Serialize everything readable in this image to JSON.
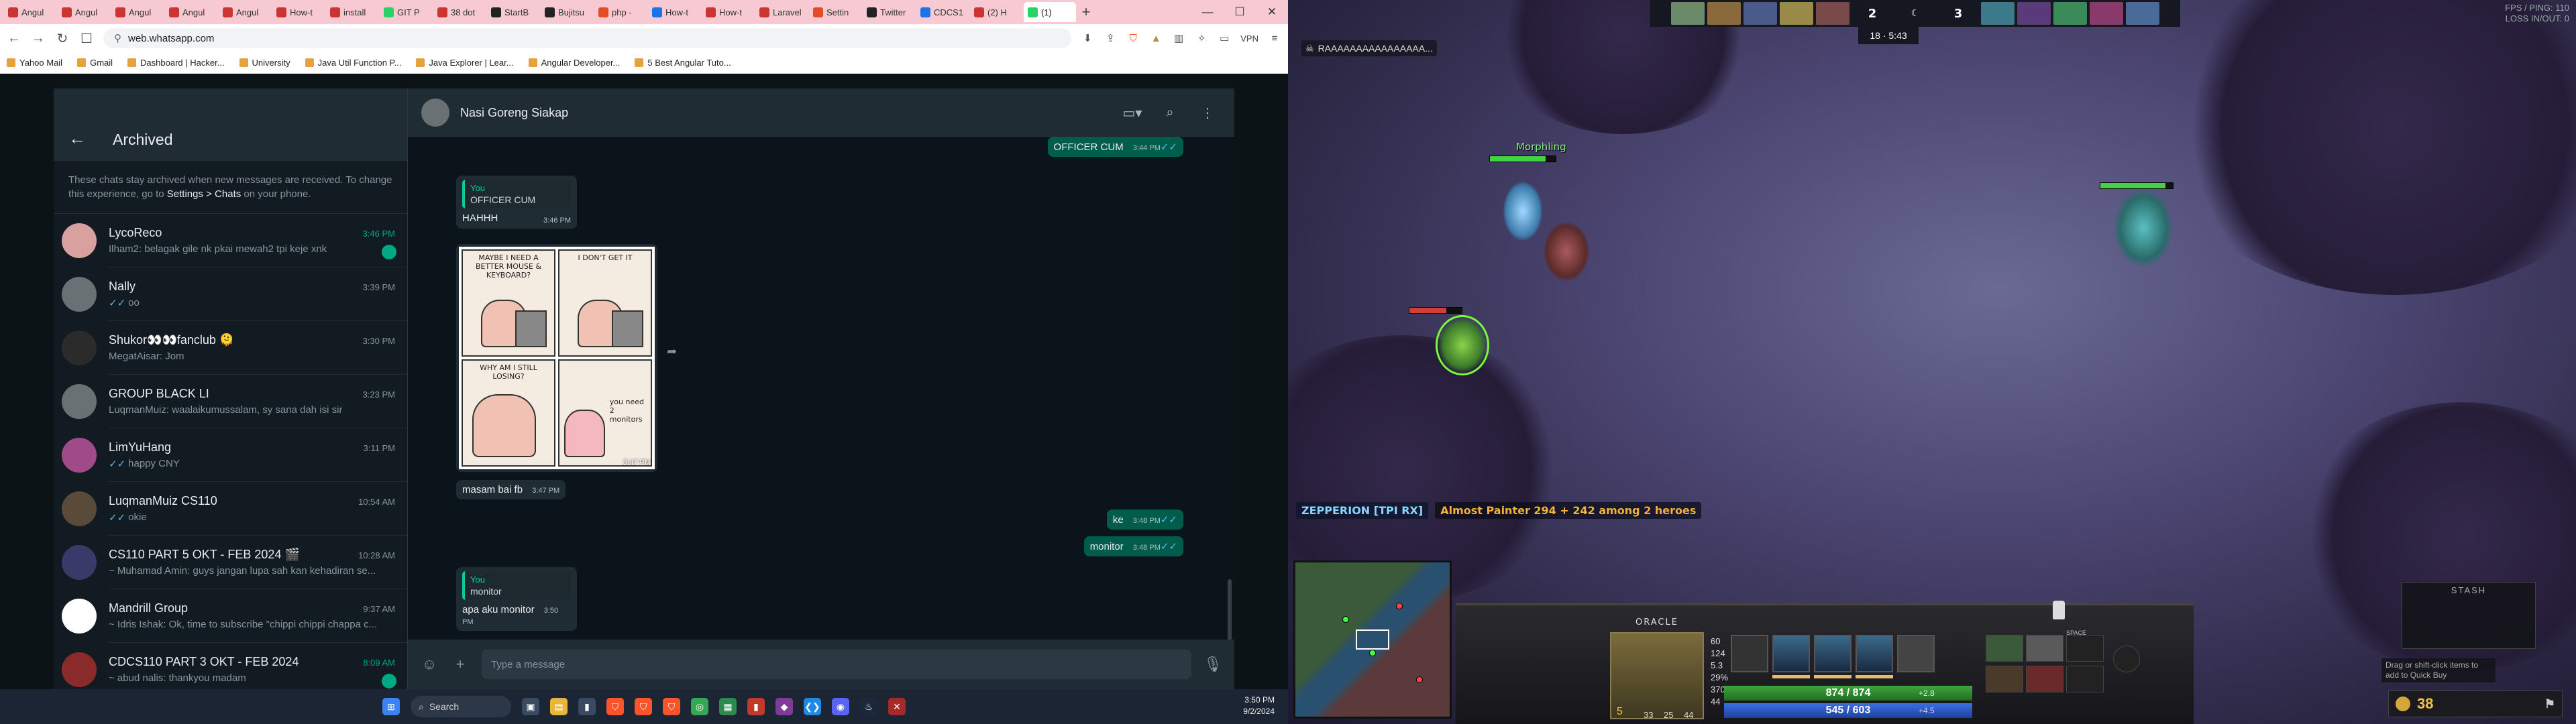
{
  "browser": {
    "tabs": [
      {
        "label": "Angul",
        "favicon": "red"
      },
      {
        "label": "Angul",
        "favicon": "red"
      },
      {
        "label": "Angul",
        "favicon": "red"
      },
      {
        "label": "Angul",
        "favicon": "red"
      },
      {
        "label": "Angul",
        "favicon": "red"
      },
      {
        "label": "How-t",
        "favicon": "red"
      },
      {
        "label": "install",
        "favicon": "red"
      },
      {
        "label": "GIT P",
        "favicon": "green"
      },
      {
        "label": "38 dot",
        "favicon": "red"
      },
      {
        "label": "StartB",
        "favicon": "dark"
      },
      {
        "label": "Bujitsu",
        "favicon": "dark"
      },
      {
        "label": "php -",
        "favicon": "orange"
      },
      {
        "label": "How-t",
        "favicon": "blue"
      },
      {
        "label": "How-t",
        "favicon": "red"
      },
      {
        "label": "Laravel",
        "favicon": "red"
      },
      {
        "label": "Settin",
        "favicon": "orange"
      },
      {
        "label": "Twitter",
        "favicon": "dark"
      },
      {
        "label": "CDCS1",
        "favicon": "blue"
      },
      {
        "label": "(2) H",
        "favicon": "red"
      },
      {
        "label": "(1)",
        "favicon": "green",
        "active": true
      }
    ],
    "url": "web.whatsapp.com",
    "extensions": [
      "VPN"
    ],
    "bookmarks": [
      "Yahoo Mail",
      "Gmail",
      "Dashboard | Hacker...",
      "University",
      "Java Util Function P...",
      "Java Explorer | Lear...",
      "Angular Developer...",
      "5 Best Angular Tuto..."
    ]
  },
  "whatsapp": {
    "archived_title": "Archived",
    "archived_note_prefix": "These chats stay archived when new messages are received. To change this experience, go to",
    "archived_note_settings": "Settings > Chats",
    "archived_note_suffix": "on your phone.",
    "chats": [
      {
        "name": "LycoReco",
        "time": "3:46 PM",
        "preview": "Ilham2: belagak gile nk pkai mewah2 tpi keje xnk",
        "unread": "",
        "green_time": true
      },
      {
        "name": "Nally",
        "time": "3:39 PM",
        "preview": "oo",
        "tick": "✓✓"
      },
      {
        "name": "Shukor👀👀fanclub 🫠",
        "time": "3:30 PM",
        "preview": "MegatAisar: Jom"
      },
      {
        "name": "GROUP BLACK LI",
        "time": "3:23 PM",
        "preview": "LuqmanMuiz: waalaikumussalam, sy sana dah isi sir"
      },
      {
        "name": "LimYuHang",
        "time": "3:11 PM",
        "preview": "happy CNY",
        "tick": "✓✓"
      },
      {
        "name": "LuqmanMuiz CS110",
        "time": "10:54 AM",
        "preview": "okie",
        "tick": "✓✓"
      },
      {
        "name": "CS110 PART 5 OKT - FEB 2024 🎬",
        "time": "10:28 AM",
        "preview": "~ Muhamad Amin: guys jangan lupa sah kan kehadiran se..."
      },
      {
        "name": "Mandrill Group",
        "time": "9:37 AM",
        "preview": "~ Idris Ishak: Ok, time to subscribe \"chippi chippi chappa c..."
      },
      {
        "name": "CDCS110 PART 3 OKT - FEB 2024",
        "time": "8:09 AM",
        "preview": "~ abud nalis: thankyou madam",
        "green_time": true
      }
    ],
    "conversation": {
      "title": "Nasi Goreng Siakap",
      "messages": [
        {
          "dir": "out",
          "text": "OFFICER CUM",
          "time": "3:44 PM"
        },
        {
          "dir": "in",
          "quote_name": "You",
          "quote_text": "OFFICER CUM",
          "text": "HAHHH",
          "time": "3:46 PM"
        },
        {
          "dir": "in",
          "image": true,
          "time": "3:47 PM",
          "comic_captions": [
            "MAYBE I NEED A BETTER MOUSE & KEYBOARD?",
            "I DON'T GET IT",
            "WHY AM I STILL LOSING?",
            "you need 2 monitors"
          ]
        },
        {
          "dir": "in",
          "text": "masam bai fb",
          "time": "3:47 PM"
        },
        {
          "dir": "out",
          "text": "ke",
          "time": "3:48 PM"
        },
        {
          "dir": "out",
          "text": "monitor",
          "time": "3:48 PM"
        },
        {
          "dir": "in",
          "quote_name": "You",
          "quote_text": "monitor",
          "text": "apa aku monitor",
          "time": "3:50 PM"
        }
      ],
      "composer_placeholder": "Type a message"
    }
  },
  "taskbar": {
    "search_label": "Search",
    "time": "3:50 PM",
    "date": "9/2/2024"
  },
  "game": {
    "score_radiant": "2",
    "score_dire": "3",
    "kills_center": "18",
    "game_time": "5:43",
    "top_right_info": [
      "FPS / PING: 110",
      "LOSS IN/OUT: 0"
    ],
    "killfeed_top": [
      "RAAAAAAAAAAAAAAAA..."
    ],
    "hero_label": "Morphling",
    "feed_player": "ZEPPERION [TPI RX]",
    "feed_message": "Almost Painter 294 + 242 among 2 heroes",
    "hero_name": "ORACLE",
    "hero_stats": [
      "60",
      "124",
      "5.3",
      "29%",
      "370",
      "44"
    ],
    "level": "5",
    "level_stats": [
      "33",
      "25",
      "44"
    ],
    "hp": "874 / 874",
    "mana": "545 / 603",
    "hp_regen": "+2.8",
    "mana_regen": "+4.5",
    "gold": "38",
    "stash_label": "STASH",
    "quick_buy_text": "Drag or shift-click items to add to Quick Buy",
    "space_label": "SPACE"
  }
}
